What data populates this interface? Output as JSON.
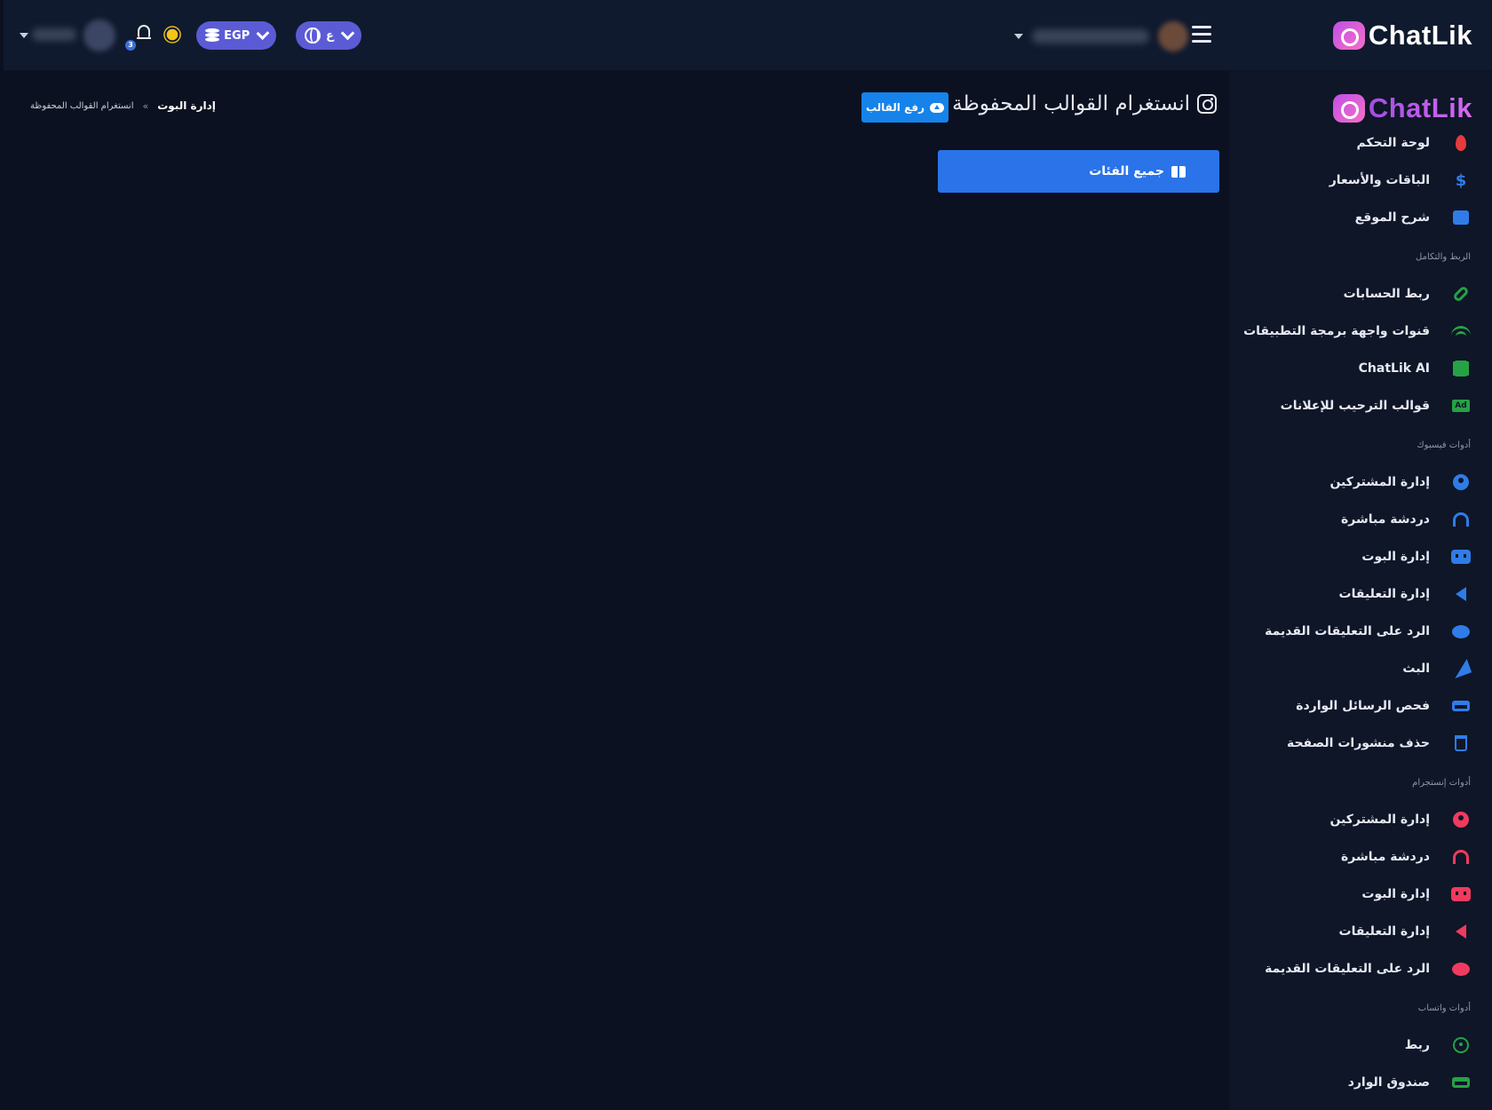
{
  "brand": {
    "name": "ChatLik"
  },
  "topbar": {
    "language_label": "ع",
    "currency_label": "EGP",
    "notification_count": "3"
  },
  "sidebar": {
    "items_top": [
      {
        "label": "لوحة التحكم",
        "icon": "flame-icon",
        "color": "#e53b3b"
      },
      {
        "label": "الباقات والأسعار",
        "icon": "dollar-icon",
        "color": "#2f7ce8"
      },
      {
        "label": "شرح الموقع",
        "icon": "presentation-icon",
        "color": "#2f7ce8"
      }
    ],
    "section_integration": "الربط والتكامل",
    "items_integration": [
      {
        "label": "ربط الحسابات",
        "icon": "link-icon",
        "color": "#25a244"
      },
      {
        "label": "قنوات واجهة برمجة التطبيقات",
        "icon": "wifi-icon",
        "color": "#25a244"
      },
      {
        "label": "ChatLik AI",
        "icon": "chip-icon",
        "color": "#25a244"
      },
      {
        "label": "قوالب الترحيب للإعلانات",
        "icon": "ad-icon",
        "color": "#25a244"
      }
    ],
    "section_facebook": "أدوات فيسبوك",
    "items_facebook": [
      {
        "label": "إدارة المشتركين",
        "icon": "user-circle-icon",
        "color": "#2f7ce8"
      },
      {
        "label": "دردشة مباشرة",
        "icon": "headset-icon",
        "color": "#2f7ce8"
      },
      {
        "label": "إدارة البوت",
        "icon": "robot-icon",
        "color": "#2f7ce8"
      },
      {
        "label": "إدارة التعليقات",
        "icon": "reply-all-icon",
        "color": "#2f7ce8"
      },
      {
        "label": "الرد على التعليقات القديمة",
        "icon": "chat-bubble-icon",
        "color": "#2f7ce8"
      },
      {
        "label": "البث",
        "icon": "paper-plane-icon",
        "color": "#2f7ce8"
      },
      {
        "label": "فحص الرسائل الواردة",
        "icon": "inbox-icon",
        "color": "#2f7ce8"
      },
      {
        "label": "حذف منشورات الصفحة",
        "icon": "trash-icon",
        "color": "#2f7ce8"
      }
    ],
    "section_instagram": "أدوات إنستجرام",
    "items_instagram": [
      {
        "label": "إدارة المشتركين",
        "icon": "user-circle-icon",
        "color": "#f03a5f"
      },
      {
        "label": "دردشة مباشرة",
        "icon": "headset-icon",
        "color": "#f03a5f"
      },
      {
        "label": "إدارة البوت",
        "icon": "robot-icon",
        "color": "#f03a5f"
      },
      {
        "label": "إدارة التعليقات",
        "icon": "reply-all-icon",
        "color": "#f03a5f"
      },
      {
        "label": "الرد على التعليقات القديمة",
        "icon": "chat-bubble-icon",
        "color": "#f03a5f"
      }
    ],
    "section_whatsapp": "أدوات واتساب",
    "items_whatsapp": [
      {
        "label": "ربط",
        "icon": "whatsapp-icon",
        "color": "#25a244"
      },
      {
        "label": "صندوق الوارد",
        "icon": "inbox-icon",
        "color": "#25a244"
      }
    ]
  },
  "main": {
    "page_title": "انستغرام القوالب المحفوظة",
    "upload_button": "رفع القالب",
    "breadcrumb": [
      "إدارة البوت",
      "انستغرام القوالب المحفوظة"
    ],
    "breadcrumb_separator": "»",
    "categories_button": "جميع الفئات"
  }
}
